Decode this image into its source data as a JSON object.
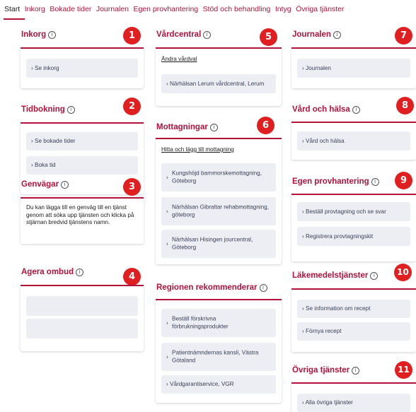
{
  "nav": {
    "tabs": [
      "Start",
      "Inkorg",
      "Bokade tider",
      "Journalen",
      "Egen provhantering",
      "Stöd och behandling",
      "Intyg",
      "Övriga tjänster"
    ]
  },
  "info_icon": "ⓘ",
  "sections": {
    "inkorg": {
      "title": "Inkorg",
      "badge": "1",
      "rows": [
        "Se inkorg"
      ]
    },
    "tidbokning": {
      "title": "Tidbokning",
      "badge": "2",
      "rows": [
        "Se bokade tider",
        "Boka tid"
      ]
    },
    "genvagar": {
      "title": "Genvägar",
      "badge": "3",
      "text": "Du kan lägga till en genväg till en tjänst genom att söka upp tjänsten och klicka på stjärnan bredvid tjänstens namn."
    },
    "agera_ombud": {
      "title": "Agera ombud",
      "badge": "4"
    },
    "vardcentral": {
      "title": "Vårdcentral",
      "badge": "5",
      "link": "Ändra vårdval",
      "rows": [
        "Närhälsan Lerum vårdcentral, Lerum"
      ]
    },
    "mottagningar": {
      "title": "Mottagningar",
      "badge": "6",
      "link": "Hitta och lägg till mottagning",
      "rows": [
        "Kungshöjd barnmorskemottagning, Göteborg",
        "Närhälsan Gibraltar rehabmottagning, göteborg",
        "Närhälsan Hisingen jourcentral, Göteborg"
      ]
    },
    "regionen": {
      "title": "Regionen rekommenderar",
      "rows": [
        "Beställ förskrivna förbrukningsprodukter",
        "Patientnämndernas kansli, Västra Götaland",
        "Vårdgarantiservice, VGR"
      ]
    },
    "journalen": {
      "title": "Journalen",
      "badge": "7",
      "rows": [
        "Journalen"
      ]
    },
    "vard_och_halsa": {
      "title": "Vård och hälsa",
      "badge": "8",
      "rows": [
        "Vård och hälsa"
      ]
    },
    "egen_provhantering": {
      "title": "Egen provhantering",
      "badge": "9",
      "rows": [
        "Beställ provtagning och se svar",
        "Registrera provtagningskit"
      ]
    },
    "lakemedel": {
      "title": "Läkemedelstjänster",
      "badge": "10",
      "rows": [
        "Se information om recept",
        "Förnya recept"
      ]
    },
    "ovriga": {
      "title": "Övriga tjänster",
      "badge": "11",
      "rows": [
        "Alla övriga tjänster"
      ]
    }
  },
  "colors": {
    "accent": "#b3123a",
    "badge": "#e02020",
    "row_bg": "#eceef3"
  }
}
